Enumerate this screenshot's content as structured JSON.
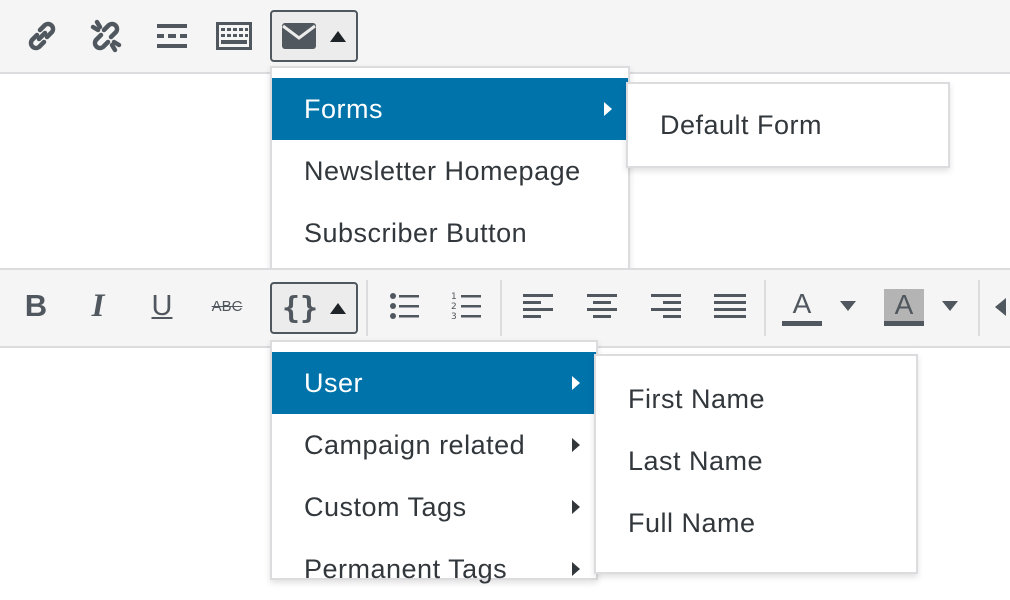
{
  "toolbar_top": {
    "buttons": [
      {
        "name": "link-icon"
      },
      {
        "name": "unlink-icon"
      },
      {
        "name": "read-more-icon"
      },
      {
        "name": "keyboard-icon"
      },
      {
        "name": "envelope-icon"
      }
    ]
  },
  "mailpoet_menu": {
    "items": [
      {
        "label": "Forms",
        "active": true,
        "has_submenu": true
      },
      {
        "label": "Newsletter Homepage",
        "active": false,
        "has_submenu": false
      },
      {
        "label": "Subscriber Button",
        "active": false,
        "has_submenu": false
      }
    ],
    "submenu": [
      {
        "label": "Default Form"
      }
    ]
  },
  "toolbar_bottom": {
    "bold_label": "B",
    "italic_label": "I",
    "underline_label": "U",
    "strike_label": "ABC",
    "shortcode_label": "{}",
    "text_color_label": "A",
    "bg_color_label": "A"
  },
  "shortcode_menu": {
    "items": [
      {
        "label": "User",
        "active": true,
        "has_submenu": true
      },
      {
        "label": "Campaign related",
        "active": false,
        "has_submenu": true
      },
      {
        "label": "Custom Tags",
        "active": false,
        "has_submenu": true
      },
      {
        "label": "Permanent Tags",
        "active": false,
        "has_submenu": true
      }
    ],
    "submenu": [
      {
        "label": "First Name"
      },
      {
        "label": "Last Name"
      },
      {
        "label": "Full Name"
      }
    ]
  },
  "colors": {
    "accent": "#0073aa",
    "toolbar_bg": "#f5f5f5",
    "border": "#dcdcde",
    "icon": "#50575e"
  }
}
